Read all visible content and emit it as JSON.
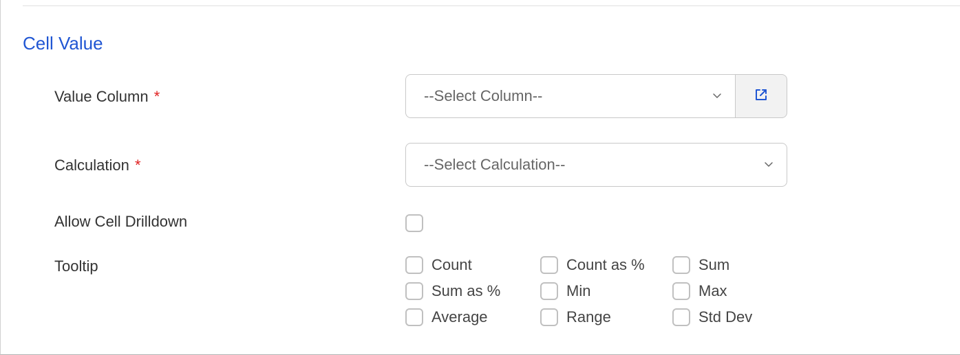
{
  "section": {
    "title": "Cell Value"
  },
  "fields": {
    "valueColumn": {
      "label": "Value Column",
      "placeholder": "--Select Column--"
    },
    "calculation": {
      "label": "Calculation",
      "placeholder": "--Select Calculation--"
    },
    "allowCellDrilldown": {
      "label": "Allow Cell Drilldown"
    },
    "tooltip": {
      "label": "Tooltip",
      "options": {
        "count": "Count",
        "countAsPct": "Count as %",
        "sum": "Sum",
        "sumAsPct": "Sum as %",
        "min": "Min",
        "max": "Max",
        "average": "Average",
        "range": "Range",
        "stdDev": "Std Dev"
      }
    }
  },
  "requiredMark": "*"
}
